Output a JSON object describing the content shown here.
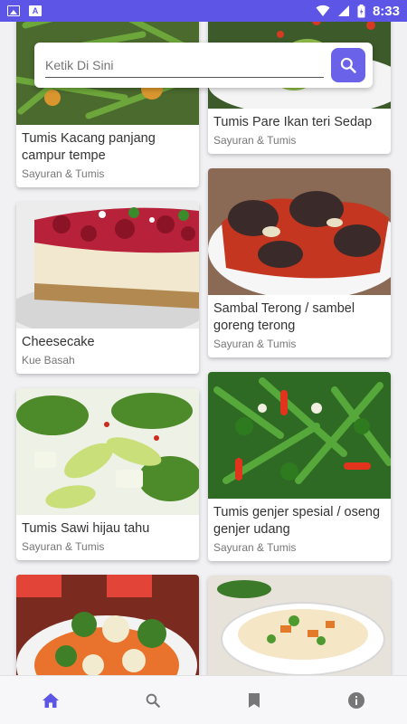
{
  "status_bar": {
    "time": "8:33"
  },
  "search": {
    "placeholder": "Ketik Di Sini"
  },
  "recipes_left": [
    {
      "title": "Tumis Kacang panjang campur tempe",
      "category": "Sayuran & Tumis"
    },
    {
      "title": "Cheesecake",
      "category": "Kue Basah"
    },
    {
      "title": "Tumis Sawi hijau tahu",
      "category": "Sayuran & Tumis"
    },
    {
      "title": "",
      "category": ""
    }
  ],
  "recipes_right": [
    {
      "title": "Tumis Pare Ikan teri Sedap",
      "category": "Sayuran & Tumis"
    },
    {
      "title": "Sambal Terong / sambel goreng terong",
      "category": "Sayuran & Tumis"
    },
    {
      "title": "Tumis genjer spesial / oseng genjer udang",
      "category": "Sayuran & Tumis"
    },
    {
      "title": "",
      "category": ""
    }
  ],
  "bottom_nav": [
    "home-icon",
    "search-icon",
    "bookmark-icon",
    "info-icon"
  ],
  "colors": {
    "accent": "#5c55e6",
    "nav_active": "#5c55e6",
    "nav_inactive": "#777777"
  }
}
